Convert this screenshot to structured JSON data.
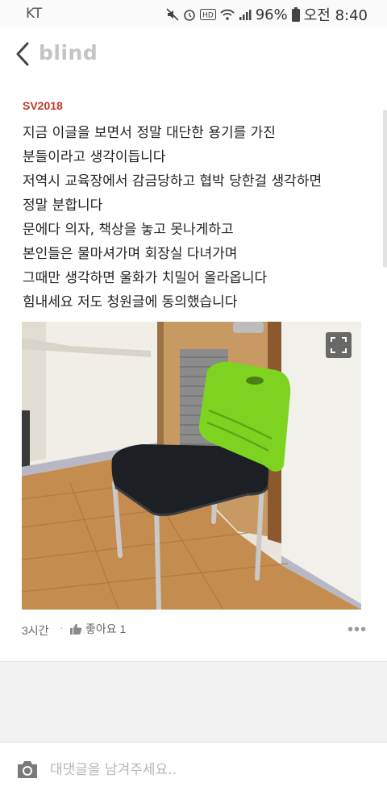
{
  "status_bar": {
    "carrier": "KT",
    "battery": "96%",
    "time": "오전 8:40",
    "icons": [
      "mute-icon",
      "alarm-icon",
      "hd-icon",
      "wifi-icon",
      "signal-icon",
      "battery-icon"
    ]
  },
  "app_bar": {
    "brand": "blind",
    "back_icon": "chevron-left-icon"
  },
  "post": {
    "author": "SV2018",
    "lines": [
      "지금 이글을 보면서 정말 대단한 용기를 가진",
      "분들이라고 생각이듭니다",
      "저역시 교육장에서 감금당하고 협박 당한걸 생각하면",
      "정말 분합니다",
      "문에다 의자, 책상을 놓고 못나게하고",
      "본인들은 물마셔가며 회장실 다녀가며",
      "그때만 생각하면 울화가 치밀어 올라옵니다",
      "힘내세요 저도 청원글에 동의했습니다"
    ],
    "photo_icon": "expand-icon",
    "meta": {
      "time": "3시간",
      "separator": "·",
      "like_label": "좋아요 1",
      "like_icon": "thumbs-up-icon",
      "more_icon": "more-icon"
    }
  },
  "comment": {
    "placeholder": "대댓글을 남겨주세요..",
    "camera_icon": "camera-icon"
  },
  "colors": {
    "author": "#c0392b",
    "brand": "#c4c4c4",
    "chair_green": "#7ed321"
  }
}
